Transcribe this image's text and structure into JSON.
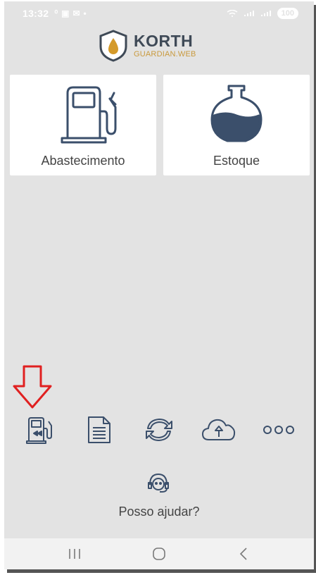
{
  "status_bar": {
    "time": "13:32",
    "battery": "100",
    "notification_icons": [
      "usb-icon",
      "teams-icon",
      "mail-icon",
      "dot-icon"
    ]
  },
  "header": {
    "logo_title": "KORTH",
    "logo_subtitle": "GUARDIAN.WEB"
  },
  "cards": [
    {
      "label": "Abastecimento",
      "icon": "fuel-pump-icon"
    },
    {
      "label": "Estoque",
      "icon": "tank-flask-icon"
    }
  ],
  "toolbar": {
    "items": [
      "fuel-rewind-icon",
      "document-icon",
      "sync-icon",
      "cloud-upload-icon",
      "more-icon"
    ],
    "more_label": "ooo"
  },
  "help": {
    "label": "Posso ajudar?",
    "icon": "headset-icon"
  },
  "nav_bar": {
    "items": [
      "recent-apps-icon",
      "home-icon",
      "back-icon"
    ]
  },
  "colors": {
    "background": "#e3e3e3",
    "icon_blue": "#3b4f6b",
    "brand_gold": "#c99a3e",
    "annotation_red": "#e02020"
  }
}
